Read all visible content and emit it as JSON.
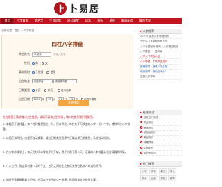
{
  "header": {
    "brand": "卜易居",
    "url": "www.buyiju.com"
  },
  "nav": [
    "首页",
    "八字算命",
    "测名字",
    "生肖运势",
    "周公解梦",
    "风水",
    "黄历",
    "星座",
    "姻缘配对",
    "算命大全"
  ],
  "breadcrumb": "当前位置：首页 > 八字排盘",
  "form": {
    "title": "四柱八字排盘",
    "name_label": "命主姓名",
    "name_value": "李某某",
    "name_hint": "请输入姓名",
    "gender_label": "性别",
    "gender_male": "男",
    "gender_female": "女",
    "true_solar_label": "真太阳时",
    "not_use": "不使用",
    "use": "使用",
    "place_label": "出生地点",
    "province_placeholder": "请选择省",
    "city_placeholder": "请选择市县",
    "calendar_label": "日期类型",
    "solar": "公历",
    "lunar": "农历",
    "leap": "闰月选择",
    "birth_label": "出生日期",
    "year": "2009",
    "month": "12",
    "day": "21",
    "hour": "12",
    "year_unit": "年",
    "month_unit": "月",
    "day_unit": "日",
    "hour_unit": "时",
    "unknown_hour": "时辰不清楚",
    "submit": "开始排盘"
  },
  "article": {
    "tip": "先在框里正确地输入出生信息，请填写真实出生时间，输入的信息我们将保密。",
    "paras": [
      "1. 本程序开放排盘，每个时间都是独立一时，所有四柱，每柱有不可改变的八字，所八个字，就称四柱八字排盘。",
      "2. 以阳历排四柱，由程序自动换算，请在日期类型选择中正确选择日期类型，系统自动切换。",
      "3. 在八字命理学上，每天的时间以零点子时开始，晚子时属于第二天，正确的八字排盘必须对精确到时辰。",
      "4. 八字五行，指定如何排八字的干支，五行之间的生克制化关系会影响人命运的好坏。",
      "5. 如果不需要精确真太阳时，也可以在出生地点中选择，时间则按北京时间计算。"
    ]
  },
  "sidebar": {
    "box1_title": "八字推荐",
    "box1_items": [
      "2023年运势八字命理分析",
      "为什么八字里有阴阳五行",
      "八字合婚配对·看两人八字是否相合",
      "八字排盘：一生命格",
      "八字入门教程大全",
      "八字命盘：十年大运流年"
    ],
    "box2_items": [
      "婚姻测算 · 姻缘八字合婚",
      "缘分测算 · 缘分合不合？",
      "生辰八字算命"
    ],
    "box3_title": "在线测试",
    "box3_items": [
      "姓名五行测试",
      "财运测试",
      "爱情测试",
      "桃花运测试",
      "事业测试",
      "称骨算命",
      "生肖配对",
      "手机号吉凶"
    ],
    "box4_title": "热门标签",
    "tags": [
      "八字",
      "算命",
      "取名",
      "周公",
      "风水",
      "运势",
      "属相",
      "解梦"
    ]
  }
}
